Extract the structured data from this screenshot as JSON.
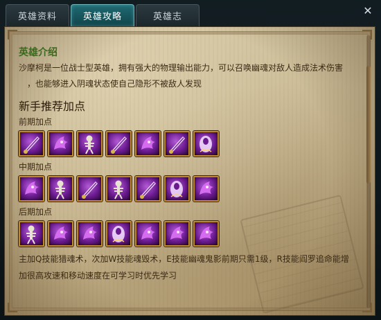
{
  "tabs": [
    {
      "label": "英雄资料",
      "active": false
    },
    {
      "label": "英雄攻略",
      "active": true
    },
    {
      "label": "英雄志",
      "active": false
    }
  ],
  "close_label": "✕",
  "intro": {
    "heading": "英雄介绍",
    "line1": "沙摩柯是一位战士型英雄，拥有强大的物理输出能力，可以召唤幽魂对敌人造成法术伤害",
    "line2": "，也能够进入阴魂状态使自己隐形不被敌人发现"
  },
  "recommend": {
    "heading": "新手推荐加点",
    "stages": [
      {
        "label": "前期加点",
        "skills": [
          "q-blade",
          "e-ghost",
          "w-skeleton",
          "q-blade",
          "e-ghost",
          "q-blade",
          "r-soul"
        ]
      },
      {
        "label": "中期加点",
        "skills": [
          "e-ghost",
          "w-skeleton",
          "q-blade",
          "w-skeleton",
          "q-blade",
          "r-soul",
          "e-ghost"
        ]
      },
      {
        "label": "后期加点",
        "skills": [
          "w-skeleton",
          "e-ghost",
          "e-ghost",
          "r-soul",
          "e-ghost",
          "e-ghost",
          "e-ghost"
        ]
      }
    ]
  },
  "tip": {
    "line1": "主加Q技能猎魂术，次加W技能魂毁术，E技能幽魂鬼影前期只需1级，R技能阎罗追命能增",
    "line2": "加很高攻速和移动速度在可学习时优先学习"
  },
  "colors": {
    "intro_heading": "#3a6a1d",
    "skill_border": "#c08a2a",
    "active_tab": "#1f6a73"
  }
}
